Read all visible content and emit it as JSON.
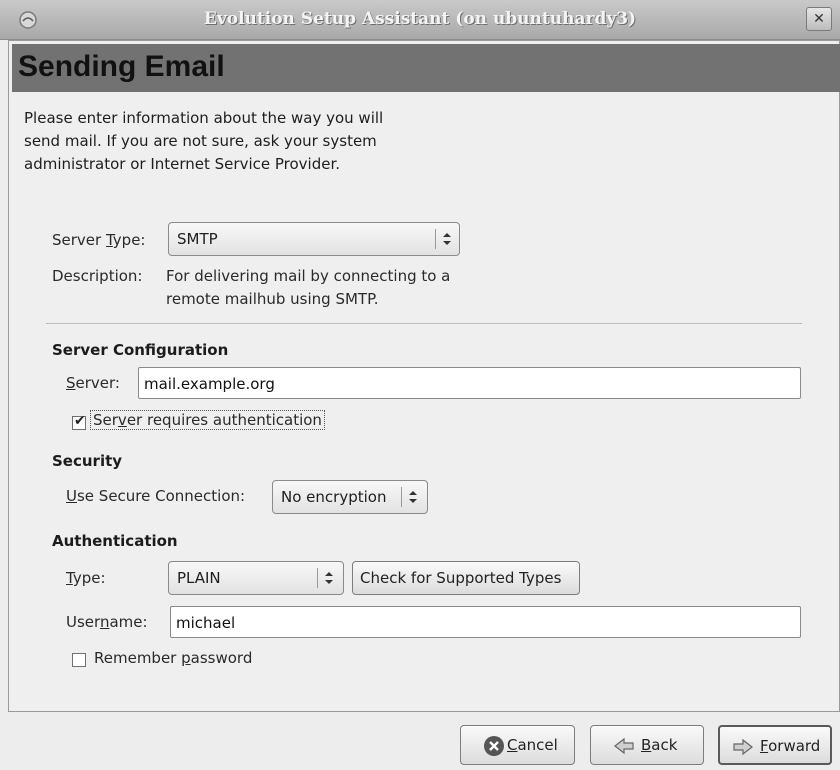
{
  "window": {
    "title": "Evolution Setup Assistant (on ubuntuhardy3)",
    "close_glyph": "✕"
  },
  "page": {
    "title": "Sending Email",
    "intro": "Please enter information about the way you will send mail. If you are not sure, ask your system administrator or Internet Service Provider."
  },
  "server_type": {
    "label_pre": "Server ",
    "label_mn": "T",
    "label_post": "ype:",
    "value": "SMTP",
    "description_label": "Description:",
    "description_line1": "For delivering mail by connecting to a",
    "description_line2": "remote mailhub using SMTP."
  },
  "server_config": {
    "heading": "Server Configuration",
    "server_label_mn": "S",
    "server_label_post": "erver:",
    "server_value": "mail.example.org",
    "auth_check_label_pre": "Ser",
    "auth_check_label_mn": "v",
    "auth_check_label_post": "er requires authentication",
    "auth_checked": true
  },
  "security": {
    "heading": "Security",
    "label_mn": "U",
    "label_post": "se Secure Connection:",
    "value": "No encryption"
  },
  "authentication": {
    "heading": "Authentication",
    "type_label_mn": "T",
    "type_label_post": "ype:",
    "type_value": "PLAIN",
    "check_button": "Check for Supported Types",
    "username_label_pre": "User",
    "username_label_mn": "n",
    "username_label_post": "ame:",
    "username_value": "michael",
    "remember_label_pre": "Remember ",
    "remember_label_mn": "p",
    "remember_label_post": "assword",
    "remember_checked": false
  },
  "buttons": {
    "cancel_mn": "C",
    "cancel_post": "ancel",
    "back_mn": "B",
    "back_post": "ack",
    "forward_mn": "F",
    "forward_post": "orward"
  },
  "icons": {
    "window": "window-menu-icon",
    "cancel": "cancel-icon",
    "back": "back-arrow-icon",
    "forward": "forward-arrow-icon",
    "combo": "combo-updown-icon"
  }
}
